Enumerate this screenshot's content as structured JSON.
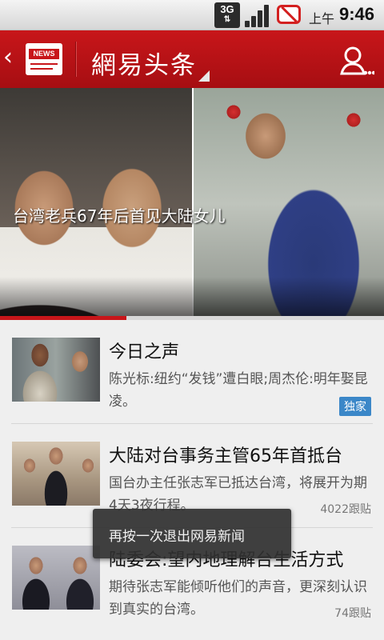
{
  "status_bar": {
    "network": "3G",
    "ampm": "上午",
    "time": "9:46"
  },
  "header": {
    "news_badge": "NEWS",
    "title": "網易头条"
  },
  "hero": {
    "caption": "台湾老兵67年后首见大陆女儿",
    "indicator_progress": 0.33
  },
  "news": [
    {
      "title": "今日之声",
      "summary": "陈光标:纽约“发钱”遭白眼;周杰伦:明年娶昆凌。",
      "badge": "独家",
      "comments": ""
    },
    {
      "title": "大陆对台事务主管65年首抵台",
      "summary": "国台办主任张志军已抵达台湾，将展开为期4天3夜行程。",
      "badge": "",
      "comments": "4022跟贴"
    },
    {
      "title": "陆委会:望内地理解台生活方式",
      "summary": "期待张志军能倾听他们的声音，更深刻认识到真实的台湾。",
      "badge": "",
      "comments": "74跟贴"
    }
  ],
  "toast": {
    "message": "再按一次退出网易新闻"
  },
  "colors": {
    "header_red": "#c8161a",
    "badge_blue": "#3b87c8"
  }
}
